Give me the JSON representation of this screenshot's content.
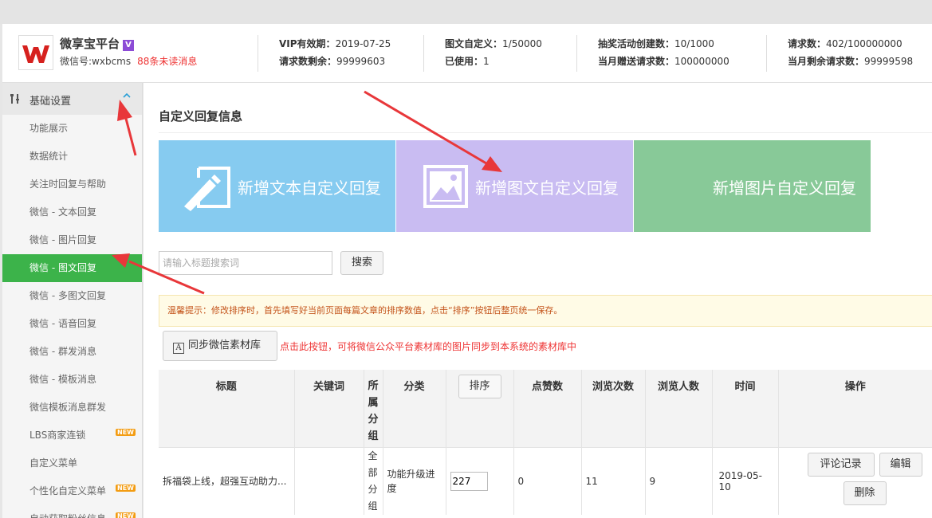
{
  "brand": {
    "name": "微享宝平台",
    "vip_badge": "V",
    "wechat_id": "微信号:wxbcms",
    "unread": "88条未读消息"
  },
  "stats": {
    "vip_expire_label": "VIP有效期：",
    "vip_expire_value": "2019-07-25",
    "req_left_label": "请求数剩余：",
    "req_left_value": "99999603",
    "news_custom_label": "图文自定义：",
    "news_custom_value": "1/50000",
    "used_label": "已使用：",
    "used_value": "1",
    "lottery_label": "抽奖活动创建数：",
    "lottery_value": "10/1000",
    "month_gift_label": "当月赠送请求数：",
    "month_gift_value": "100000000",
    "requests_label": "请求数：",
    "requests_value": "402/100000000",
    "month_left_label": "当月剩余请求数：",
    "month_left_value": "99999598"
  },
  "sidebar": {
    "section": "基础设置",
    "items": [
      {
        "label": "功能展示",
        "new": false
      },
      {
        "label": "数据统计",
        "new": false
      },
      {
        "label": "关注时回复与帮助",
        "new": false
      },
      {
        "label": "微信 - 文本回复",
        "new": false
      },
      {
        "label": "微信 - 图片回复",
        "new": false
      },
      {
        "label": "微信 - 图文回复",
        "new": false,
        "active": true
      },
      {
        "label": "微信 - 多图文回复",
        "new": false
      },
      {
        "label": "微信 - 语音回复",
        "new": false
      },
      {
        "label": "微信 - 群发消息",
        "new": false
      },
      {
        "label": "微信 - 模板消息",
        "new": false
      },
      {
        "label": "微信模板消息群发",
        "new": false
      },
      {
        "label": "LBS商家连锁",
        "new": true
      },
      {
        "label": "自定义菜单",
        "new": false
      },
      {
        "label": "个性化自定义菜单",
        "new": true
      },
      {
        "label": "自动获取粉丝信息",
        "new": true
      }
    ],
    "new_tag": "NEW"
  },
  "main": {
    "title": "自定义回复信息",
    "tiles": {
      "text": "新增文本自定义回复",
      "news": "新增图文自定义回复",
      "image": "新增图片自定义回复"
    },
    "search_placeholder": "请输入标题搜索词",
    "search_button": "搜索",
    "tip": "温馨提示：修改排序时，首先填写好当前页面每篇文章的排序数值，点击“排序”按钮后整页统一保存。",
    "sync_button": "同步微信素材库",
    "sync_icon": "A",
    "sync_note": "点击此按钮，可将微信公众平台素材库的图片同步到本系统的素材库中",
    "table": {
      "headers": {
        "title": "标题",
        "keyword": "关键词",
        "group": "所属分组",
        "category": "分类",
        "sort": "排序",
        "likes": "点赞数",
        "views": "浏览次数",
        "visitors": "浏览人数",
        "time": "时间",
        "ops": "操作"
      },
      "rows": [
        {
          "title": "拆福袋上线，超强互动助力...",
          "keyword": "",
          "group": "全部分组",
          "category": "功能升级进度",
          "order": "227",
          "likes": "0",
          "views": "11",
          "visitors": "9",
          "time": "2019-05-10",
          "btn_comments": "评论记录",
          "btn_edit": "编辑",
          "btn_delete": "删除"
        }
      ]
    }
  },
  "colors": {
    "tile_text": "#86cbf0",
    "tile_news": "#c9bcf2",
    "tile_image": "#88c998",
    "active_nav": "#3cb34a",
    "arrow": "#e8373a"
  }
}
